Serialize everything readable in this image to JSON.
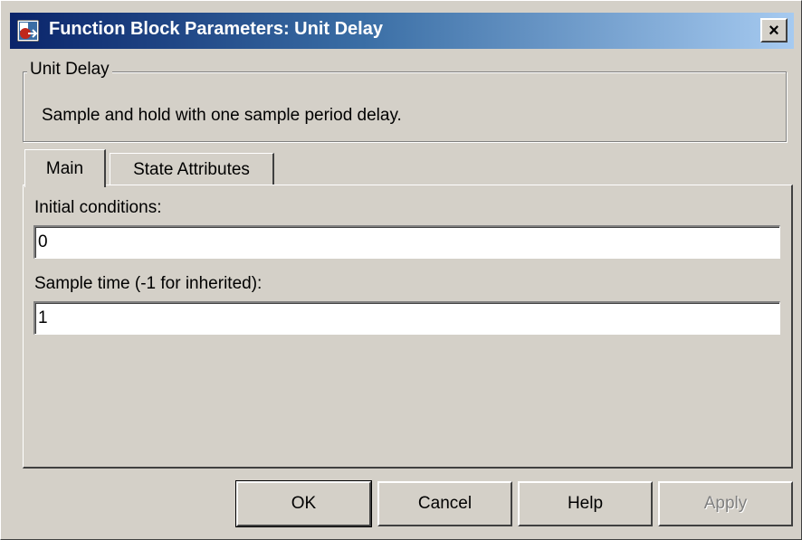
{
  "window": {
    "title": "Function Block Parameters: Unit Delay",
    "close_label": "×",
    "icon": "simulink-block-icon"
  },
  "group": {
    "legend": "Unit Delay",
    "description": "Sample and hold with one sample period delay."
  },
  "tabs": [
    {
      "label": "Main",
      "selected": true
    },
    {
      "label": "State Attributes",
      "selected": false
    }
  ],
  "fields": {
    "initial_conditions": {
      "label": "Initial conditions:",
      "value": "0"
    },
    "sample_time": {
      "label": "Sample time (-1 for inherited):",
      "value": "1"
    }
  },
  "buttons": {
    "ok": "OK",
    "cancel": "Cancel",
    "help": "Help",
    "apply": "Apply"
  },
  "colors": {
    "titlebar_start": "#0a246a",
    "titlebar_end": "#a6caf0",
    "dialog_face": "#d4d0c8"
  }
}
